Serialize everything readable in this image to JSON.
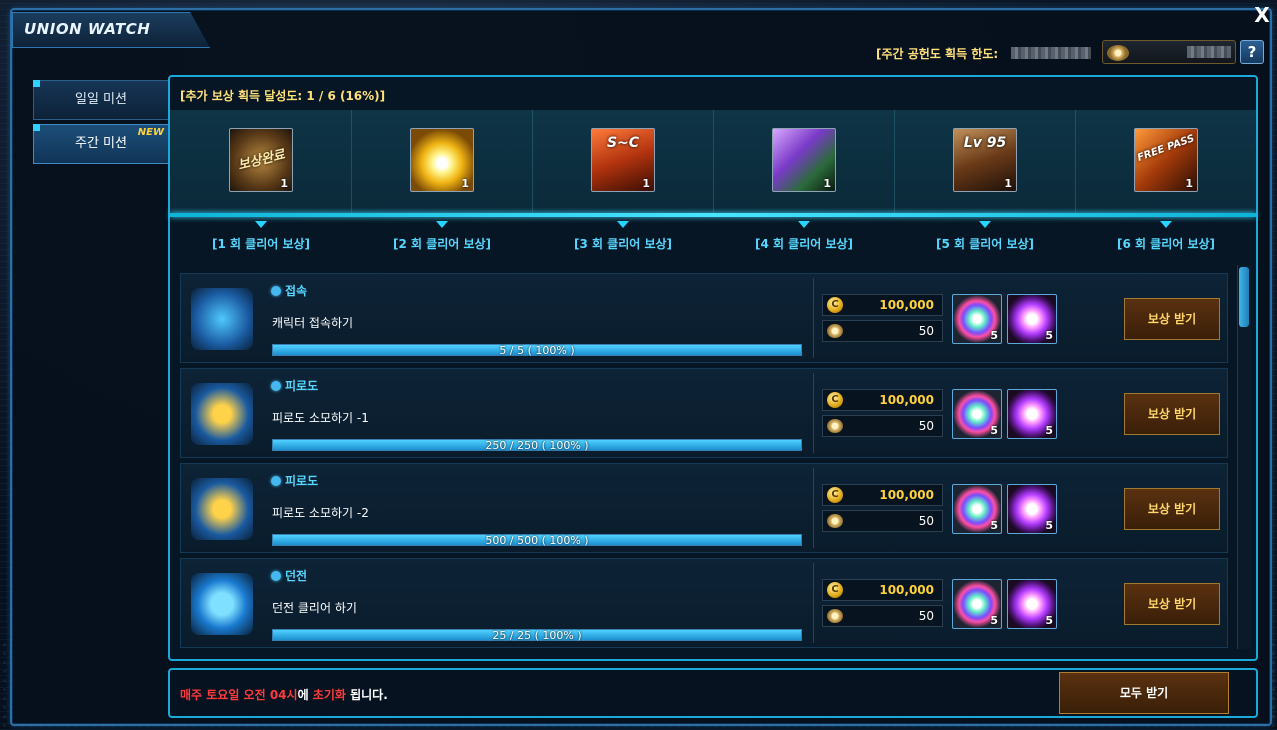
{
  "window": {
    "title": "UNION WATCH",
    "close_symbol": "X"
  },
  "header": {
    "weekly_limit_label": "[주간 공헌도 획득 한도:",
    "help_symbol": "?"
  },
  "side_tabs": [
    {
      "label": "일일 미션",
      "active": false
    },
    {
      "label": "주간 미션",
      "active": true,
      "badge": "NEW"
    }
  ],
  "bonus": {
    "progress_text": "[추가 보상 획득 달성도: 1 / 6 (16%)]",
    "rewards": [
      {
        "label": "[1 회 클리어 보상]",
        "icon": "reward-complete-seal-icon",
        "icon_text": "보상완료",
        "count": "1"
      },
      {
        "label": "[2 회 클리어 보상]",
        "icon": "light-burst-icon",
        "icon_text": "",
        "count": "1"
      },
      {
        "label": "[3 회 클리어 보상]",
        "icon": "spark-plug-sc-icon",
        "icon_text": "S~C",
        "count": "1"
      },
      {
        "label": "[4 회 클리어 보상]",
        "icon": "fuel-capsule-icon",
        "icon_text": "",
        "count": "1"
      },
      {
        "label": "[5 회 클리어 보상]",
        "icon": "spark-plug-lv95-icon",
        "icon_text": "Lv 95",
        "count": "1"
      },
      {
        "label": "[6 회 클리어 보상]",
        "icon": "free-pass-icon",
        "icon_text": "FREE PASS",
        "count": "1"
      }
    ]
  },
  "missions": [
    {
      "category": "접속",
      "name": "캐릭터 접속하기",
      "progress_text": "5 / 5 ( 100% )",
      "progress": 1.0,
      "icon": "calendar-icon",
      "gold": "100,000",
      "points": "50",
      "item1_count": "5",
      "item2_count": "5",
      "claim_label": "보상 받기"
    },
    {
      "category": "피로도",
      "name": "피로도 소모하기 -1",
      "progress_text": "250 / 250 ( 100% )",
      "progress": 1.0,
      "icon": "bottles-icon",
      "gold": "100,000",
      "points": "50",
      "item1_count": "5",
      "item2_count": "5",
      "claim_label": "보상 받기"
    },
    {
      "category": "피로도",
      "name": "피로도 소모하기 -2",
      "progress_text": "500 / 500 ( 100% )",
      "progress": 1.0,
      "icon": "bottles-icon",
      "gold": "100,000",
      "points": "50",
      "item1_count": "5",
      "item2_count": "5",
      "claim_label": "보상 받기"
    },
    {
      "category": "던전",
      "name": "던전 클리어 하기",
      "progress_text": "25 / 25 ( 100% )",
      "progress": 1.0,
      "icon": "globe-icon",
      "gold": "100,000",
      "points": "50",
      "item1_count": "5",
      "item2_count": "5",
      "claim_label": "보상 받기"
    }
  ],
  "footer": {
    "reset_day": "매주 토요일 오전 04시",
    "reset_mid": "에 ",
    "reset_word": "초기화",
    "reset_end": " 됩니다.",
    "claim_all_label": "모두 받기"
  }
}
